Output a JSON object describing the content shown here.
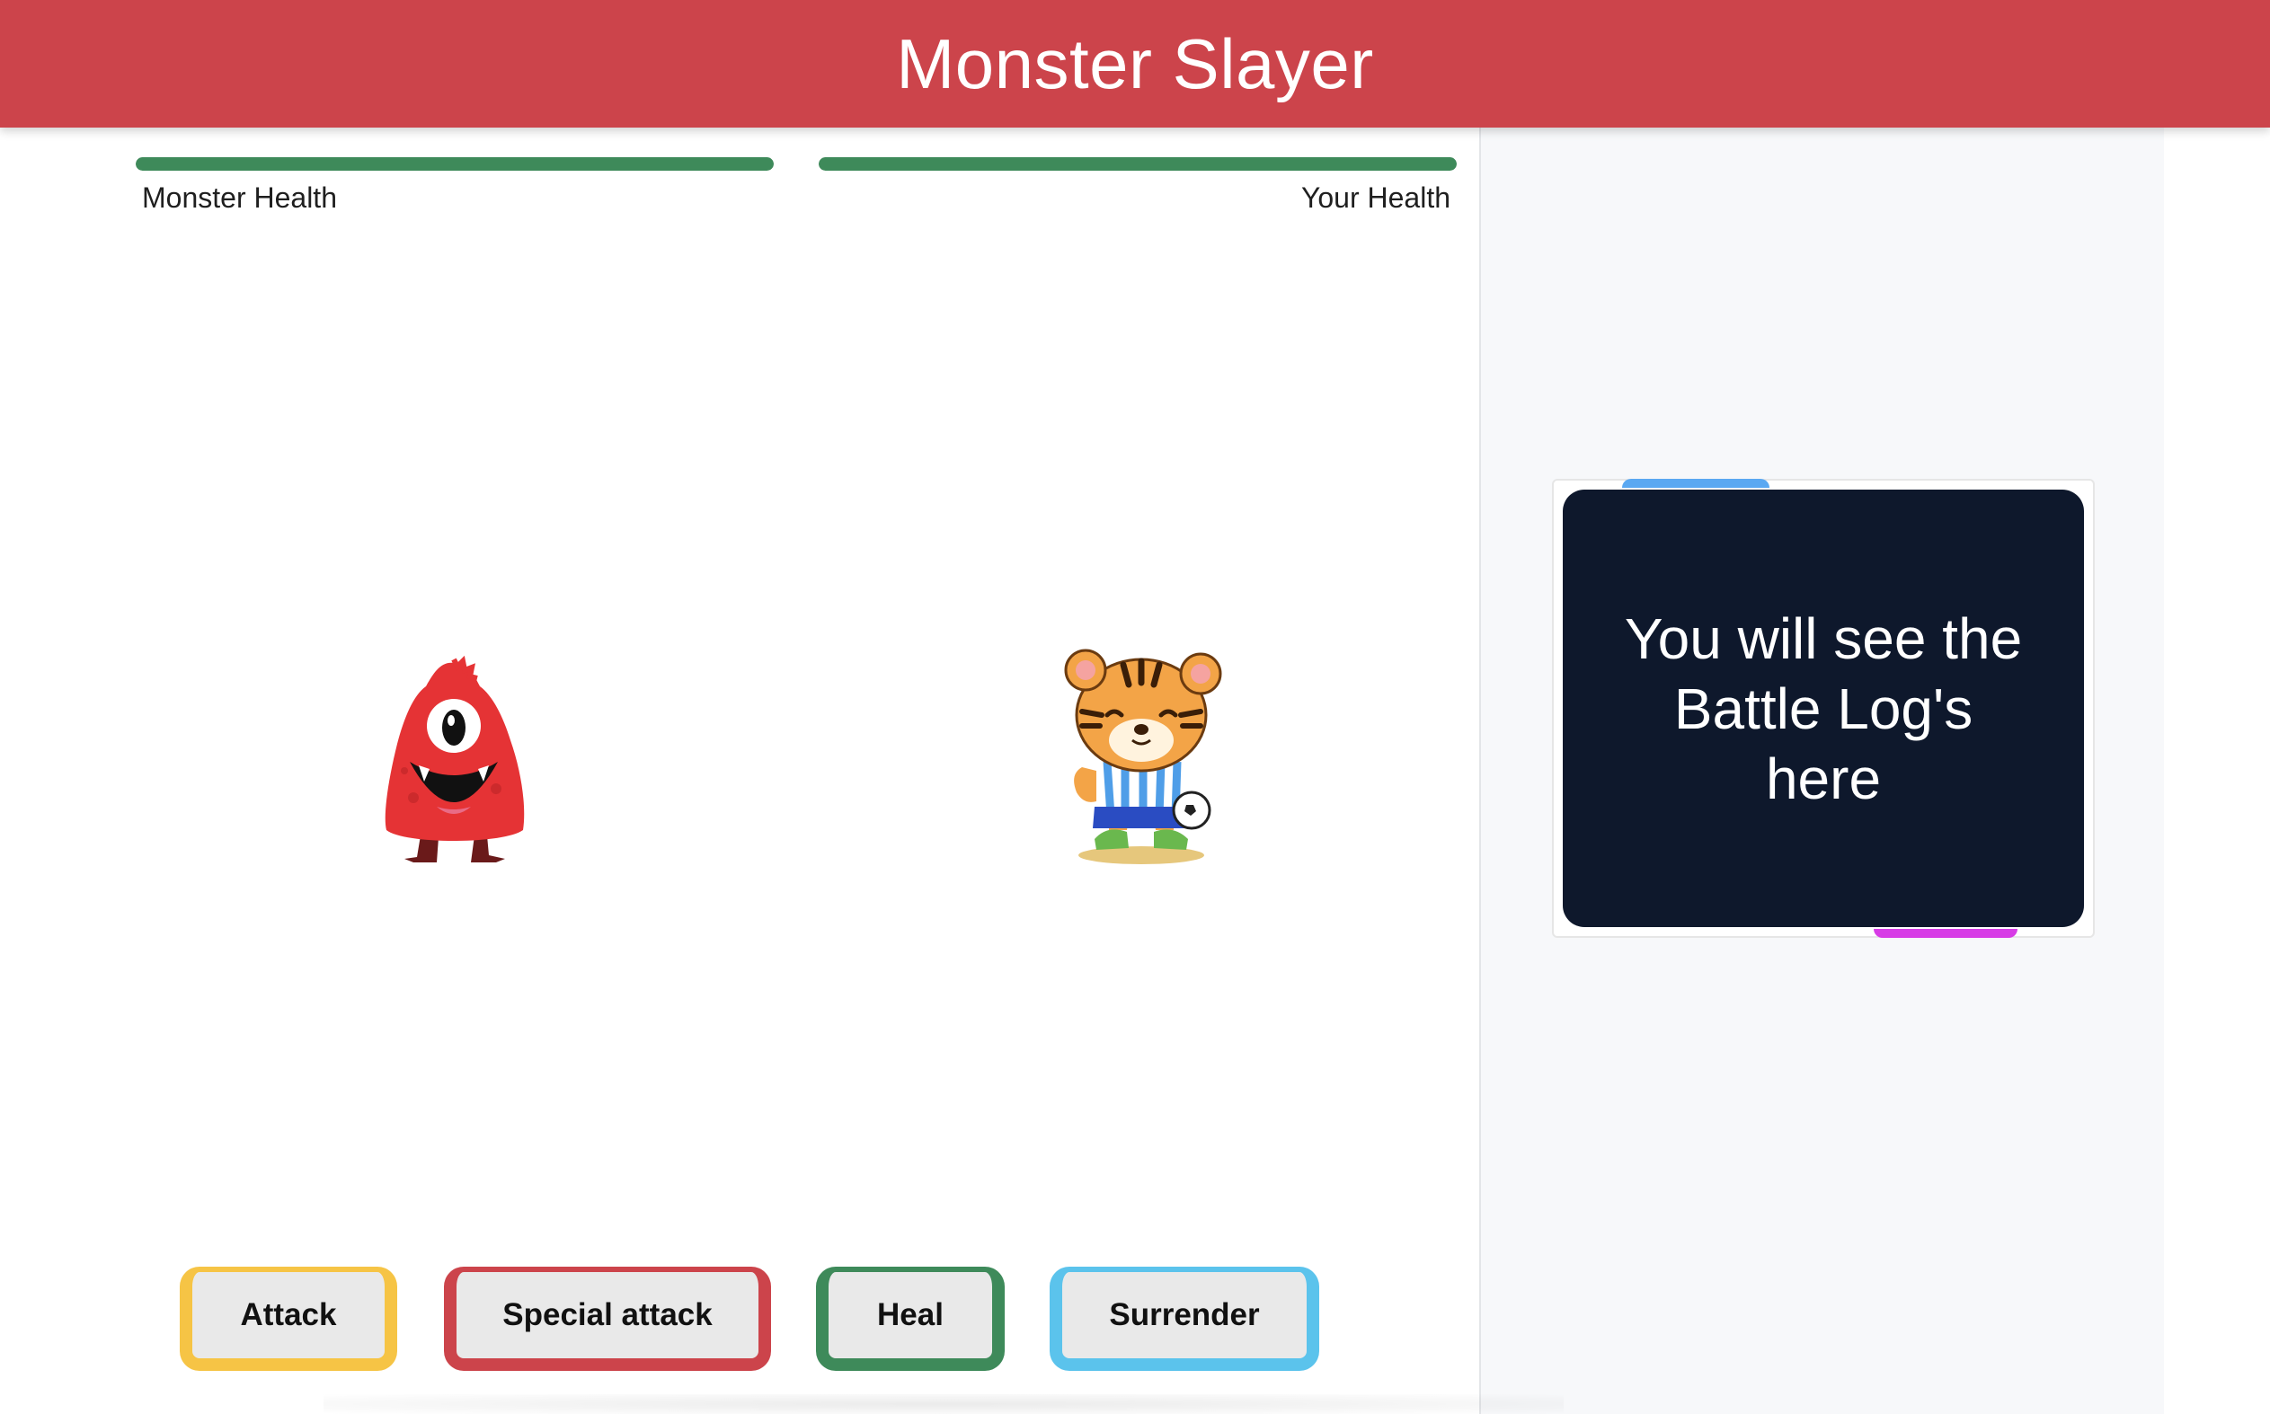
{
  "header": {
    "title": "Monster Slayer"
  },
  "monster": {
    "health_label": "Monster Health",
    "health_percent": 100,
    "sprite_icon": "red-one-eyed-monster"
  },
  "player": {
    "health_label": "Your Health",
    "health_percent": 100,
    "sprite_icon": "tiger-football-player"
  },
  "battle_log": {
    "placeholder": "You will see the Battle Log's here"
  },
  "actions": [
    {
      "label": "Attack",
      "color": "#f6c445"
    },
    {
      "label": "Special attack",
      "color": "#cc444b"
    },
    {
      "label": "Heal",
      "color": "#3e8a5a"
    },
    {
      "label": "Surrender",
      "color": "#5bc3ec"
    }
  ],
  "colors": {
    "header": "#cc444b",
    "health_fill": "#3e8a5a",
    "log_background": "#0e182c"
  }
}
